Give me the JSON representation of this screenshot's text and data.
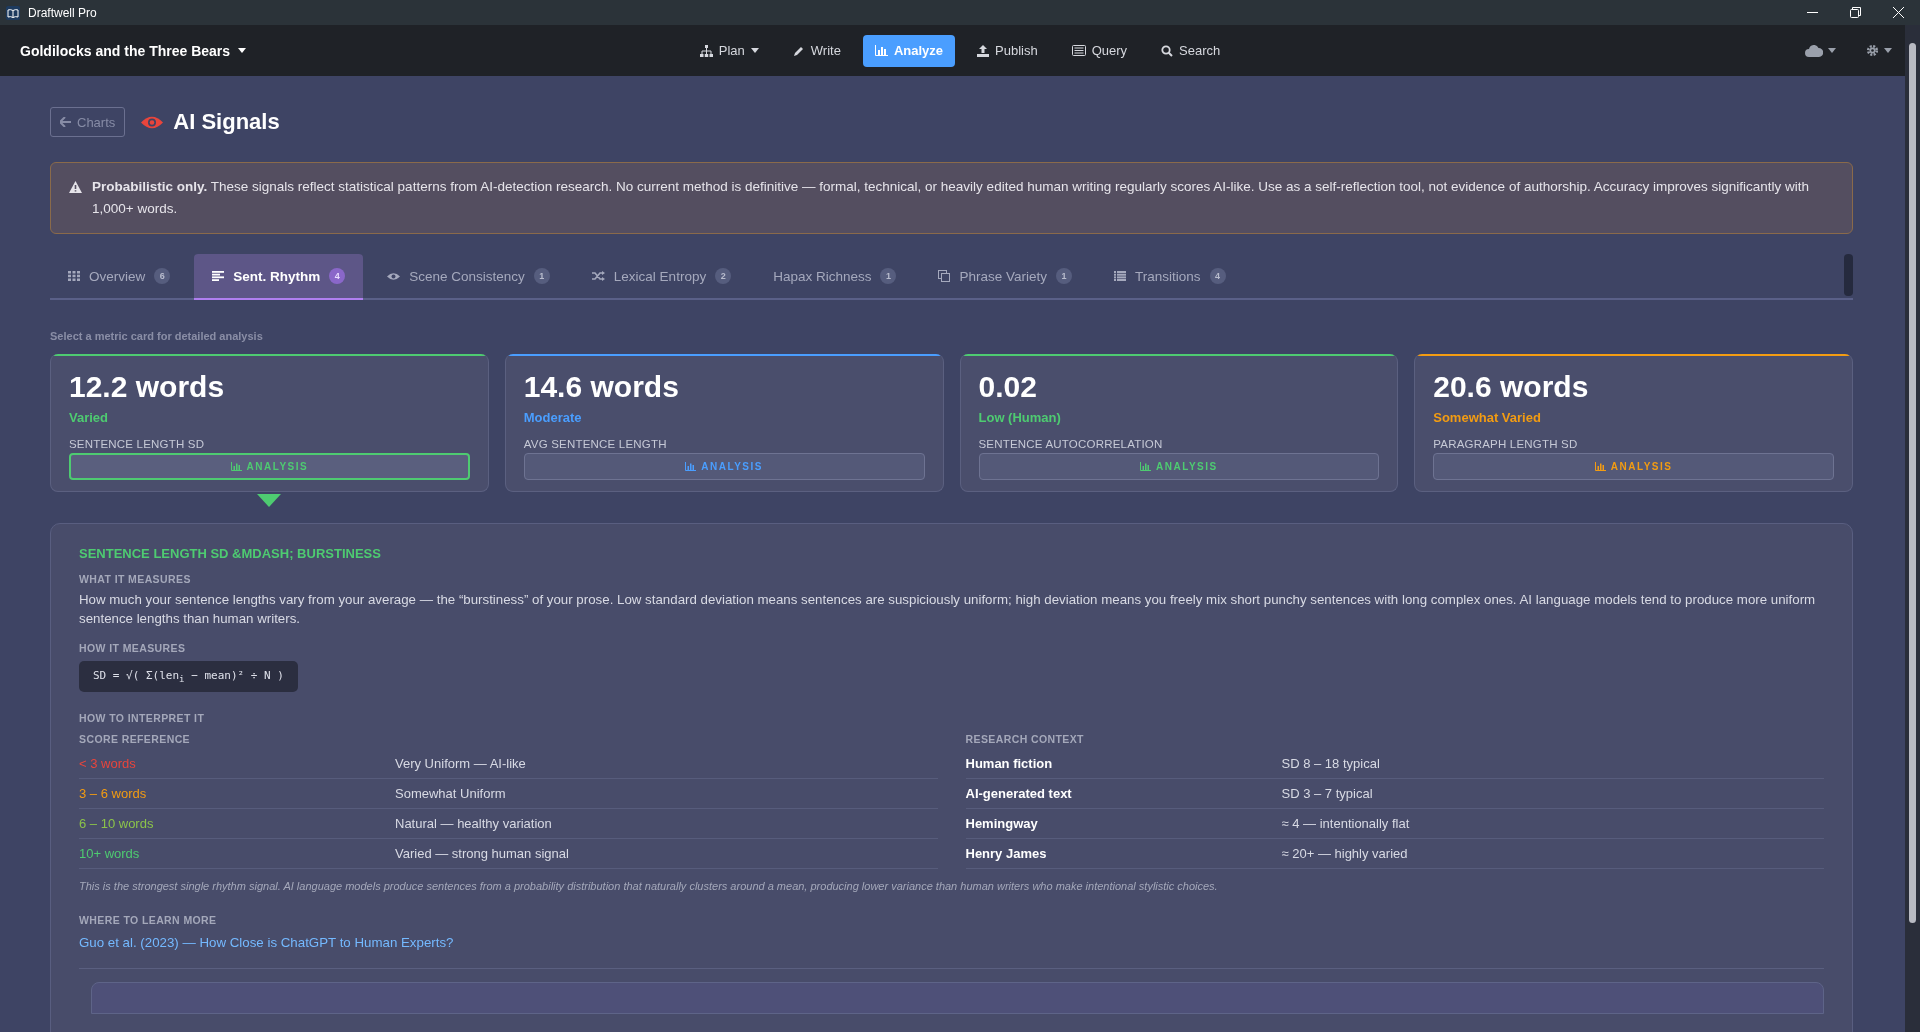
{
  "window": {
    "title": "Draftwell Pro"
  },
  "nav": {
    "project": "Goldilocks and the Three Bears",
    "items": [
      {
        "label": "Plan",
        "selected": false,
        "dropdown": true
      },
      {
        "label": "Write",
        "selected": false,
        "dropdown": false
      },
      {
        "label": "Analyze",
        "selected": true,
        "dropdown": false
      },
      {
        "label": "Publish",
        "selected": false,
        "dropdown": false
      },
      {
        "label": "Query",
        "selected": false,
        "dropdown": false
      },
      {
        "label": "Search",
        "selected": false,
        "dropdown": false
      }
    ]
  },
  "header": {
    "back_button": "Charts",
    "title": "AI Signals"
  },
  "alert": {
    "text": "**Probabilistic only.** These signals reflect statistical patterns from AI-detection research. No current method is definitive — formal, technical, or heavily edited human writing regularly scores AI-like. Use as a self-reflection tool, not evidence of authorship. Accuracy improves significantly with 1,000+ words."
  },
  "tabs": [
    {
      "label": "Overview",
      "count": "6",
      "selected": false
    },
    {
      "label": "Sent. Rhythm",
      "count": "4",
      "selected": true
    },
    {
      "label": "Scene Consistency",
      "count": "1",
      "selected": false
    },
    {
      "label": "Lexical Entropy",
      "count": "2",
      "selected": false
    },
    {
      "label": "Hapax Richness",
      "count": "1",
      "selected": false
    },
    {
      "label": "Phrase Variety",
      "count": "1",
      "selected": false
    },
    {
      "label": "Transitions",
      "count": "4",
      "selected": false
    }
  ],
  "hint": "Select a metric card for detailed analysis",
  "cards": [
    {
      "value": "12.2 words",
      "rating": "Varied",
      "label": "SENTENCE LENGTH SD",
      "button": "ANALYSIS",
      "color": "#4ecb71",
      "selected": true
    },
    {
      "value": "14.6 words",
      "rating": "Moderate",
      "label": "AVG SENTENCE LENGTH",
      "button": "ANALYSIS",
      "color": "#4a9eff",
      "selected": false
    },
    {
      "value": "0.02",
      "rating": "Low (Human)",
      "label": "SENTENCE AUTOCORRELATION",
      "button": "ANALYSIS",
      "color": "#4ecb71",
      "selected": false
    },
    {
      "value": "20.6 words",
      "rating": "Somewhat Varied",
      "label": "PARAGRAPH LENGTH SD",
      "button": "ANALYSIS",
      "color": "#f39c12",
      "selected": false
    }
  ],
  "detail": {
    "title": "SENTENCE LENGTH SD &MDASH; BURSTINESS",
    "what_heading": "WHAT IT MEASURES",
    "what_text": "How much your sentence lengths vary from your average — the “burstiness” of your prose. Low standard deviation means sentences are suspiciously uniform; high deviation means you freely mix short punchy sentences with long complex ones. AI language models tend to produce more uniform sentence lengths than human writers.",
    "how_heading": "HOW IT MEASURES",
    "formula": "SD = √( Σ(len$_{i}$ − mean)² ÷ N )",
    "interpret_heading": "HOW TO INTERPRET IT",
    "score_heading": "SCORE REFERENCE",
    "scores": [
      {
        "range": "< 3 words",
        "meaning": "Very Uniform — AI-like",
        "color": "#e8453c"
      },
      {
        "range": "3 – 6 words",
        "meaning": "Somewhat Uniform",
        "color": "#f39c12"
      },
      {
        "range": "6 – 10 words",
        "meaning": "Natural — healthy variation",
        "color": "#8bc34a"
      },
      {
        "range": "10+ words",
        "meaning": "Varied — strong human signal",
        "color": "#4ecb71"
      }
    ],
    "research_heading": "RESEARCH CONTEXT",
    "research": [
      {
        "label": "Human fiction",
        "value": "SD 8 – 18 typical"
      },
      {
        "label": "AI-generated text",
        "value": "SD 3 – 7 typical"
      },
      {
        "label": "Hemingway",
        "value": "≈ 4 — intentionally flat"
      },
      {
        "label": "Henry James",
        "value": "≈ 20+ — highly varied"
      }
    ],
    "note": "This is the strongest single rhythm signal. AI language models produce sentences from a probability distribution that naturally clusters around a mean, producing lower variance than human writers who make intentional stylistic choices.",
    "learn_heading": "WHERE TO LEARN MORE",
    "link": "Guo et al. (2023) — How Close is ChatGPT to Human Experts?"
  }
}
